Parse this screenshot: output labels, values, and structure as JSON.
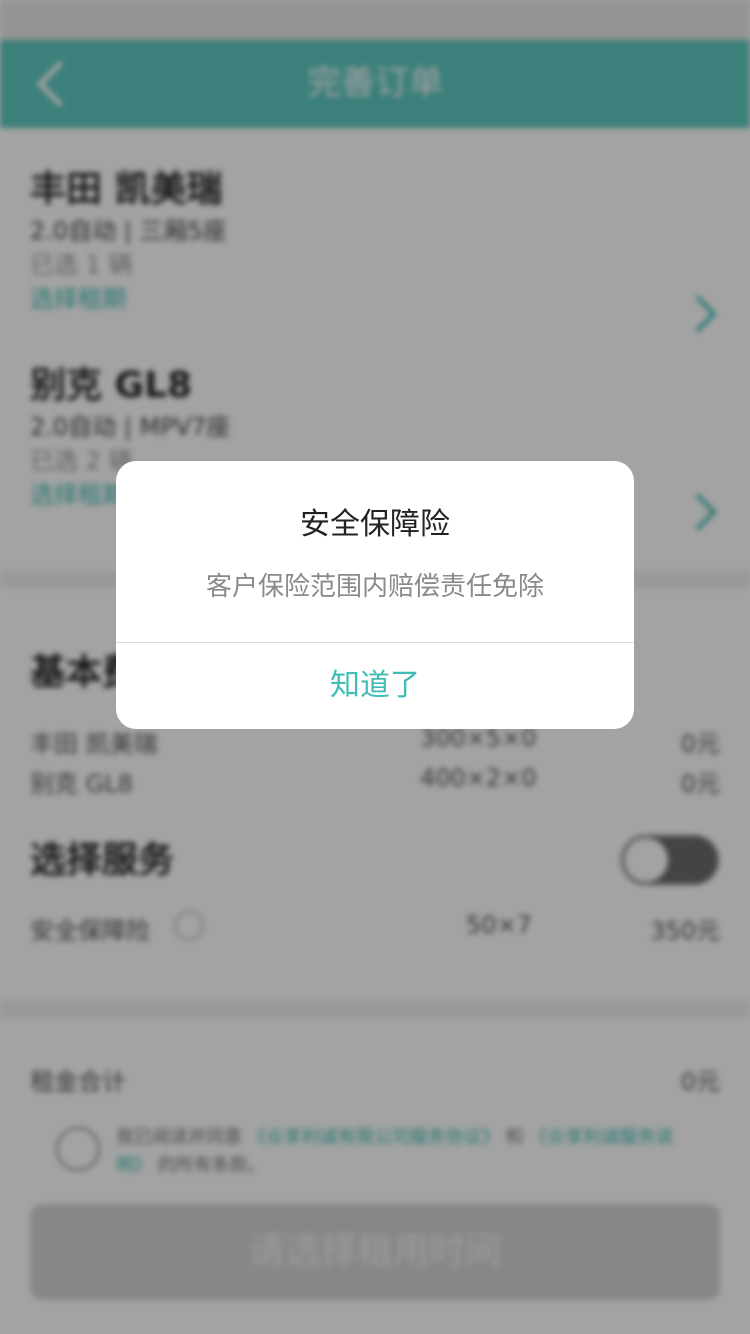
{
  "nav": {
    "title": "完善订单"
  },
  "cars": [
    {
      "name": "丰田 凯美瑞",
      "spec": "2.0自动 | 三厢5座",
      "count": "已选 1 辆",
      "pick": "选择租期"
    },
    {
      "name": "别克 GL8",
      "spec": "2.0自动 | MPV7座",
      "count": "已选 2 辆",
      "pick": "选择租期"
    }
  ],
  "basic": {
    "title": "基本费用",
    "rows": [
      {
        "name": "丰田 凯美瑞",
        "formula": "300×5×0",
        "amount": "0元"
      },
      {
        "name": "别克 GL8",
        "formula": "400×2×0",
        "amount": "0元"
      }
    ]
  },
  "services": {
    "title": "选择服务",
    "toggle_on": false,
    "rows": [
      {
        "name": "安全保障险",
        "formula": "50×7",
        "amount": "350元"
      }
    ]
  },
  "total": {
    "label": "租金合计",
    "amount": "0元"
  },
  "agreement": {
    "prefix": "我已阅读并同意",
    "link1": "《众享利诚有限公司服务协议》",
    "mid": "和",
    "link2": "《众享利诚服务说明》",
    "suffix": "的所有条款。"
  },
  "cta": {
    "label": "请选择租用时间"
  },
  "dialog": {
    "title": "安全保障险",
    "message": "客户保险范围内赔偿责任免除",
    "button": "知道了"
  },
  "colors": {
    "accent": "#3fbdb4",
    "nav": "#5ec8c0"
  },
  "icons": {
    "back": "chevron-left",
    "chevron": "chevron-right",
    "help": "question-circle",
    "check": "check-circle"
  }
}
